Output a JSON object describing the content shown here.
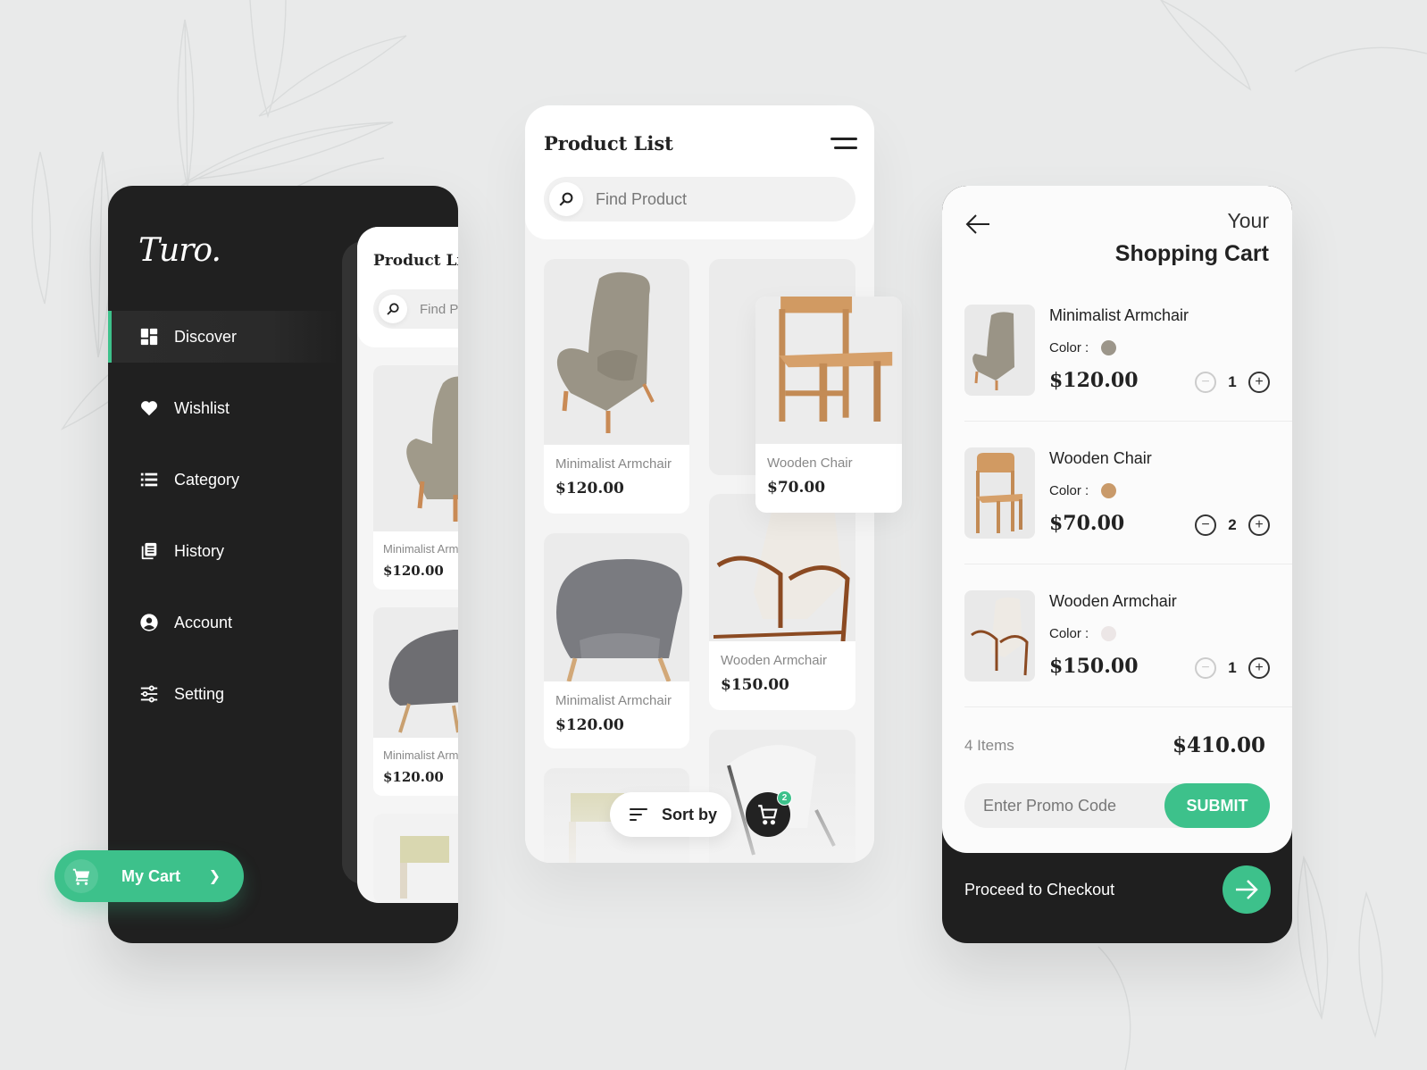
{
  "colors": {
    "accent": "#3dc18b",
    "dark": "#202020",
    "background": "#e9eaea"
  },
  "sidebar": {
    "logo": "Turo.",
    "items": [
      {
        "label": "Discover",
        "icon": "grid-icon",
        "active": true
      },
      {
        "label": "Wishlist",
        "icon": "heart-icon",
        "active": false
      },
      {
        "label": "Category",
        "icon": "list-icon",
        "active": false
      },
      {
        "label": "History",
        "icon": "history-icon",
        "active": false
      },
      {
        "label": "Account",
        "icon": "account-icon",
        "active": false
      },
      {
        "label": "Setting",
        "icon": "sliders-icon",
        "active": false
      }
    ],
    "my_cart_label": "My Cart",
    "preview": {
      "title": "Product List",
      "search_placeholder": "Find Product",
      "cards": [
        {
          "name": "Minimalist Armchair",
          "price": "$120.00"
        },
        {
          "name": "Minimalist Armchair",
          "price": "$120.00"
        }
      ]
    }
  },
  "product_list": {
    "title": "Product List",
    "search_placeholder": "Find Product",
    "products": [
      {
        "name": "Minimalist Armchair",
        "price": "$120.00"
      },
      {
        "name": "Wooden Chair",
        "price": "$70.00"
      },
      {
        "name": "Minimalist Armchair",
        "price": "$120.00"
      },
      {
        "name": "Wooden Armchair",
        "price": "$150.00"
      }
    ],
    "sort_label": "Sort by",
    "cart_badge": "2"
  },
  "cart": {
    "title_small": "Your",
    "title": "Shopping Cart",
    "color_label": "Color :",
    "items": [
      {
        "name": "Minimalist Armchair",
        "color": "#9c968a",
        "price": "$120.00",
        "qty": "1",
        "minus_disabled": true
      },
      {
        "name": "Wooden Chair",
        "color": "#c99a6a",
        "price": "$70.00",
        "qty": "2",
        "minus_disabled": false
      },
      {
        "name": "Wooden Armchair",
        "color": "#ece6e6",
        "price": "$150.00",
        "qty": "1",
        "minus_disabled": true
      }
    ],
    "items_count": "4 Items",
    "total": "$410.00",
    "promo_placeholder": "Enter Promo Code",
    "submit_label": "SUBMIT",
    "checkout_label": "Proceed to Checkout"
  }
}
